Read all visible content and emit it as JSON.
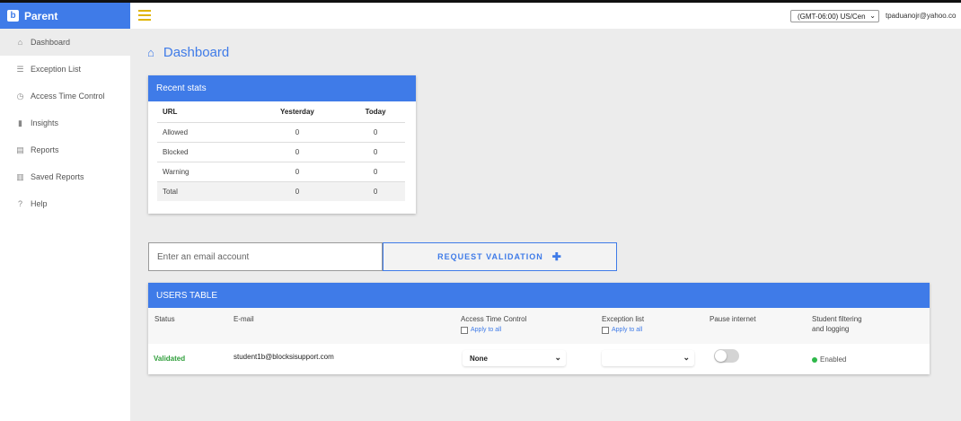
{
  "app": {
    "name": "Parent",
    "logo_letter": "b"
  },
  "header": {
    "timezone": "(GMT-06:00) US/Cen",
    "user_email": "tpaduanojr@yahoo.co"
  },
  "sidebar": {
    "items": [
      {
        "label": "Dashboard",
        "icon": "home-icon"
      },
      {
        "label": "Exception List",
        "icon": "list-icon"
      },
      {
        "label": "Access Time Control",
        "icon": "clock-icon"
      },
      {
        "label": "Insights",
        "icon": "bar-chart-icon"
      },
      {
        "label": "Reports",
        "icon": "document-icon"
      },
      {
        "label": "Saved Reports",
        "icon": "saved-document-icon"
      },
      {
        "label": "Help",
        "icon": "help-icon"
      }
    ]
  },
  "page": {
    "title": "Dashboard"
  },
  "recent_stats": {
    "title": "Recent stats",
    "columns": [
      "URL",
      "Yesterday",
      "Today"
    ],
    "rows": [
      [
        "Allowed",
        "0",
        "0"
      ],
      [
        "Blocked",
        "0",
        "0"
      ],
      [
        "Warning",
        "0",
        "0"
      ],
      [
        "Total",
        "0",
        "0"
      ]
    ]
  },
  "request": {
    "placeholder": "Enter an email account",
    "button_label": "REQUEST VALIDATION",
    "button_icon": "plus-icon"
  },
  "users_table": {
    "title": "USERS TABLE",
    "columns": {
      "status": "Status",
      "email": "E-mail",
      "access_time": "Access Time Control",
      "exception": "Exception list",
      "pause": "Pause internet",
      "filtering_line1": "Student filtering",
      "filtering_line2": "and logging"
    },
    "apply_to_all": "Apply to all",
    "row": {
      "status": "Validated",
      "email": "student1b@blocksisupport.com",
      "access_time_value": "None",
      "exception_value": "",
      "pause_internet": false,
      "filtering": "Enabled"
    }
  },
  "colors": {
    "accent": "#3f7be8",
    "validated": "#2e9e3a",
    "enabled_dot": "#2eb84a",
    "hamburger": "#e0b400"
  }
}
